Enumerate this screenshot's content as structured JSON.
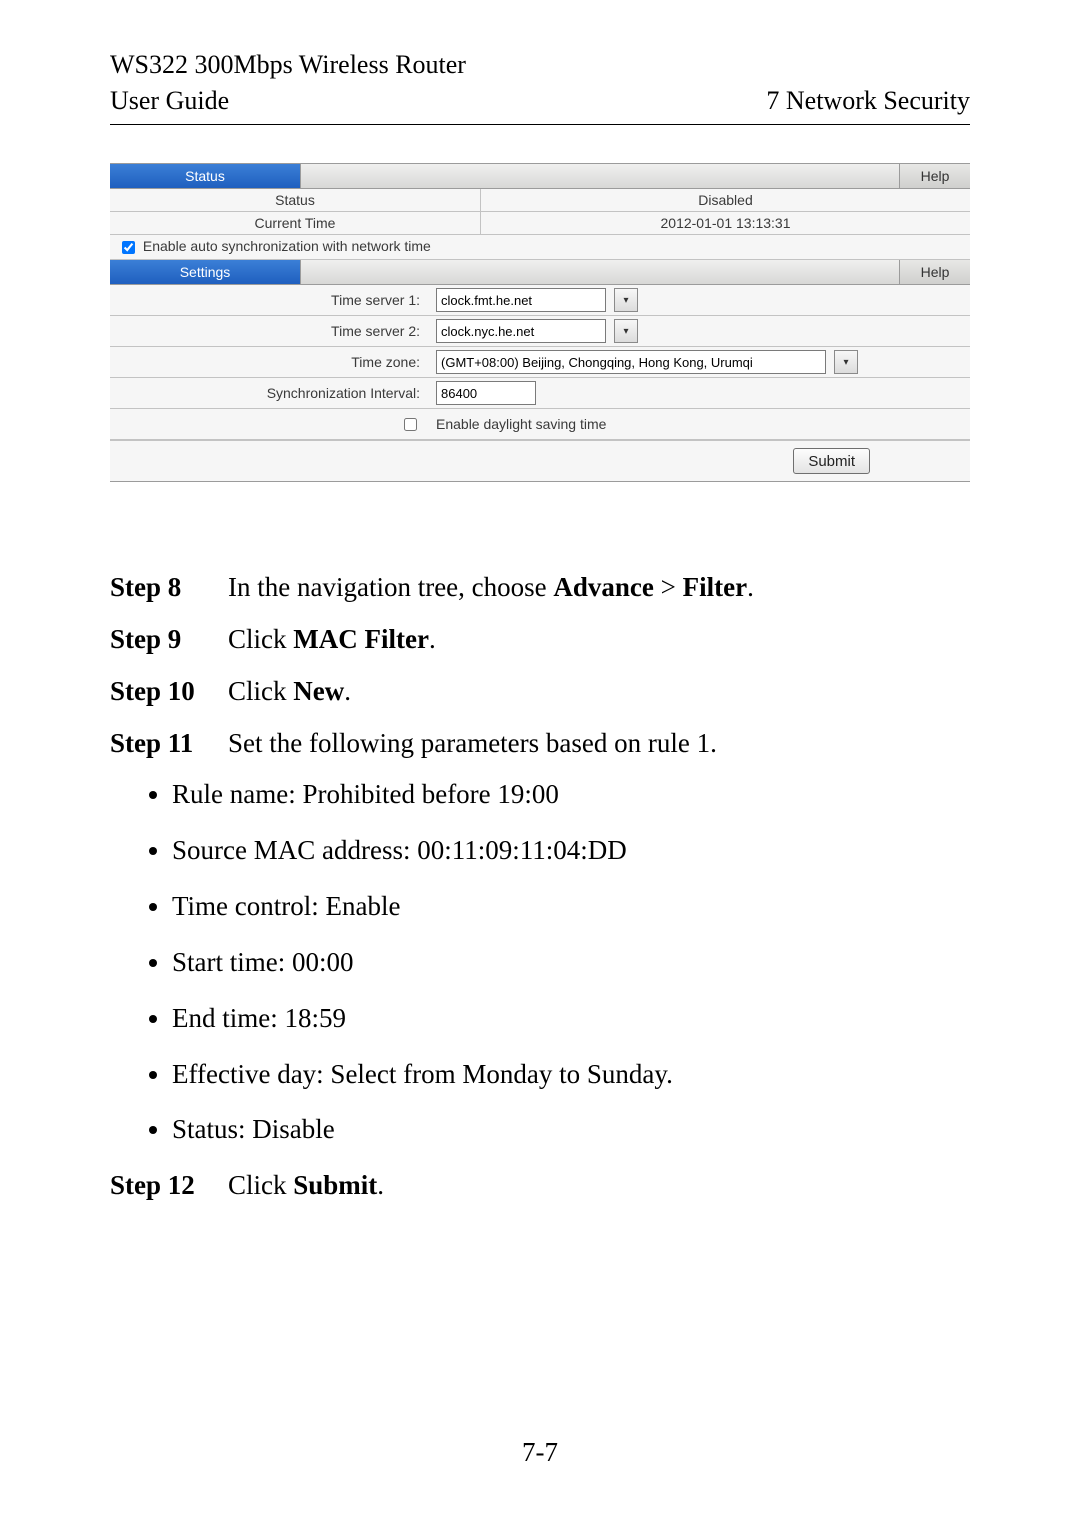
{
  "header": {
    "product": "WS322 300Mbps Wireless Router",
    "left": "User Guide",
    "right": "7 Network Security"
  },
  "shot": {
    "status_tab": "Status",
    "help": "Help",
    "status_label": "Status",
    "status_value": "Disabled",
    "time_label": "Current Time",
    "time_value": "2012-01-01 13:13:31",
    "enable_sync": "Enable auto synchronization with network time",
    "settings_tab": "Settings",
    "ts1_label": "Time server 1:",
    "ts1_value": "clock.fmt.he.net",
    "ts2_label": "Time server 2:",
    "ts2_value": "clock.nyc.he.net",
    "tz_label": "Time zone:",
    "tz_value": "(GMT+08:00) Beijing, Chongqing, Hong Kong, Urumqi",
    "sync_label": "Synchronization Interval:",
    "sync_value": "86400",
    "dst_label": "Enable daylight saving time",
    "submit": "Submit"
  },
  "steps": {
    "s8_num": "Step 8",
    "s8_a": "In the navigation tree, choose ",
    "s8_b": "Advance",
    "s8_c": " > ",
    "s8_d": "Filter",
    "s8_e": ".",
    "s9_num": "Step 9",
    "s9_a": "Click ",
    "s9_b": "MAC Filter",
    "s9_c": ".",
    "s10_num": "Step 10",
    "s10_a": "Click ",
    "s10_b": "New",
    "s10_c": ".",
    "s11_num": "Step 11",
    "s11_body": "Set the following parameters based on rule 1.",
    "b1": "Rule name: Prohibited before 19:00",
    "b2": "Source MAC address: 00:11:09:11:04:DD",
    "b3": "Time control: Enable",
    "b4": "Start time: 00:00",
    "b5": "End time: 18:59",
    "b6": "Effective day: Select from Monday to Sunday.",
    "b7": "Status: Disable",
    "s12_num": "Step 12",
    "s12_a": "Click ",
    "s12_b": "Submit",
    "s12_c": "."
  },
  "footer": "7-7"
}
